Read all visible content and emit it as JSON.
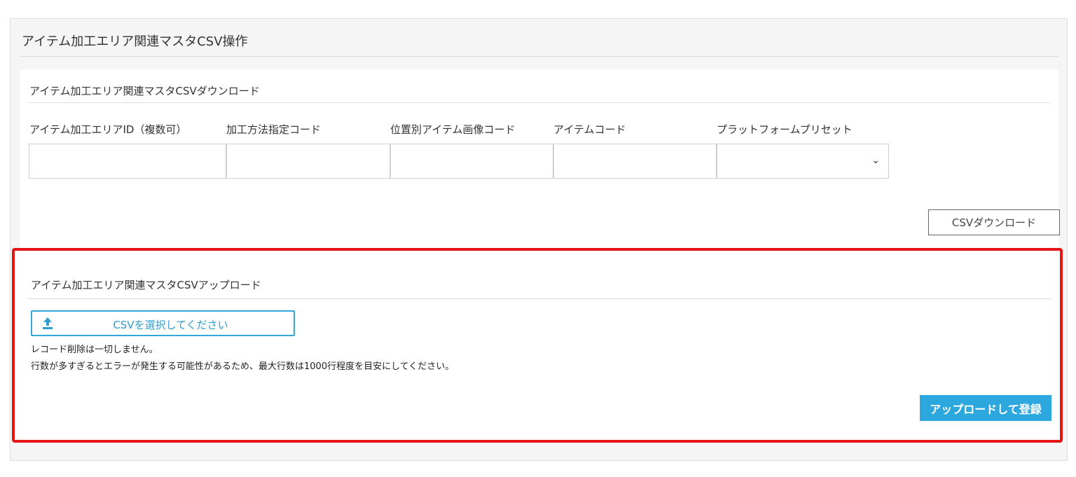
{
  "page": {
    "title": "アイテム加工エリア関連マスタCSV操作"
  },
  "download": {
    "title": "アイテム加工エリア関連マスタCSVダウンロード",
    "fields": [
      {
        "label": "アイテム加工エリアID（複数可）",
        "value": ""
      },
      {
        "label": "加工方法指定コード",
        "value": ""
      },
      {
        "label": "位置別アイテム画像コード",
        "value": ""
      },
      {
        "label": "アイテムコード",
        "value": ""
      },
      {
        "label": "プラットフォームプリセット",
        "value": "",
        "chevron": "⌄"
      }
    ],
    "button_label": "CSVダウンロード"
  },
  "upload": {
    "title": "アイテム加工エリア関連マスタCSVアップロード",
    "file_button_label": "CSVを選択してください",
    "file_button_icon": "upload-icon",
    "notes": [
      "レコード削除は一切しません。",
      "行数が多すぎるとエラーが発生する可能性があるため、最大行数は1000行程度を目安にしてください。"
    ],
    "submit_label": "アップロードして登録"
  },
  "colors": {
    "highlight_border": "#e41616",
    "accent": "#2ca8df",
    "panel_bg": "#f5f5f5"
  }
}
